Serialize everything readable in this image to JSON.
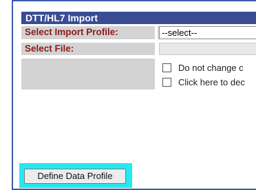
{
  "panel": {
    "title": "DTT/HL7 Import"
  },
  "form": {
    "import_profile_label": "Select Import Profile:",
    "import_profile_value": "--select--",
    "file_label": "Select File:",
    "options": [
      {
        "label": "Do not change c",
        "checked": false
      },
      {
        "label": "Click here to dec",
        "checked": false
      }
    ]
  },
  "actions": {
    "define_profile_label": "Define Data Profile"
  },
  "colors": {
    "title_bar": "#3a4c94",
    "label_text": "#8b1a1a",
    "cell_background": "#d3d3d3",
    "focus_highlight": "#27e7f0"
  }
}
